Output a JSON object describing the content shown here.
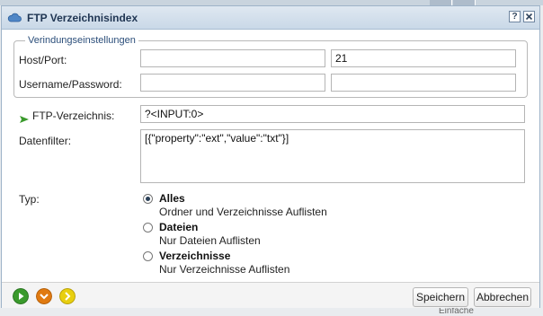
{
  "window": {
    "title": "FTP Verzeichnisindex",
    "help_glyph": "?",
    "close_glyph": "X"
  },
  "connection": {
    "legend": "Verindungseinstellungen",
    "host_port_label": "Host/Port:",
    "host_value": "",
    "port_value": "21",
    "user_pass_label": "Username/Password:",
    "username_value": "",
    "password_value": ""
  },
  "ftp_dir": {
    "label": "FTP-Verzeichnis:",
    "value": "?<INPUT:0>"
  },
  "filter": {
    "label": "Datenfilter:",
    "value": "[{\"property\":\"ext\",\"value\":\"txt\"}]"
  },
  "type": {
    "label": "Typ:",
    "options": [
      {
        "title": "Alles",
        "desc": "Ordner und Verzeichnisse Auflisten",
        "checked": true
      },
      {
        "title": "Dateien",
        "desc": "Nur Dateien Auflisten",
        "checked": false
      },
      {
        "title": "Verzeichnisse",
        "desc": "Nur Verzeichnisse Auflisten",
        "checked": false
      }
    ]
  },
  "footer": {
    "save_label": "Speichern",
    "cancel_label": "Abbrechen"
  },
  "background": {
    "partial_text": "Einfache"
  },
  "colors": {
    "accent_green": "#3a9a2c",
    "accent_orange": "#e07a10",
    "accent_yellow": "#e8cf10",
    "title_text": "#1f3552"
  }
}
